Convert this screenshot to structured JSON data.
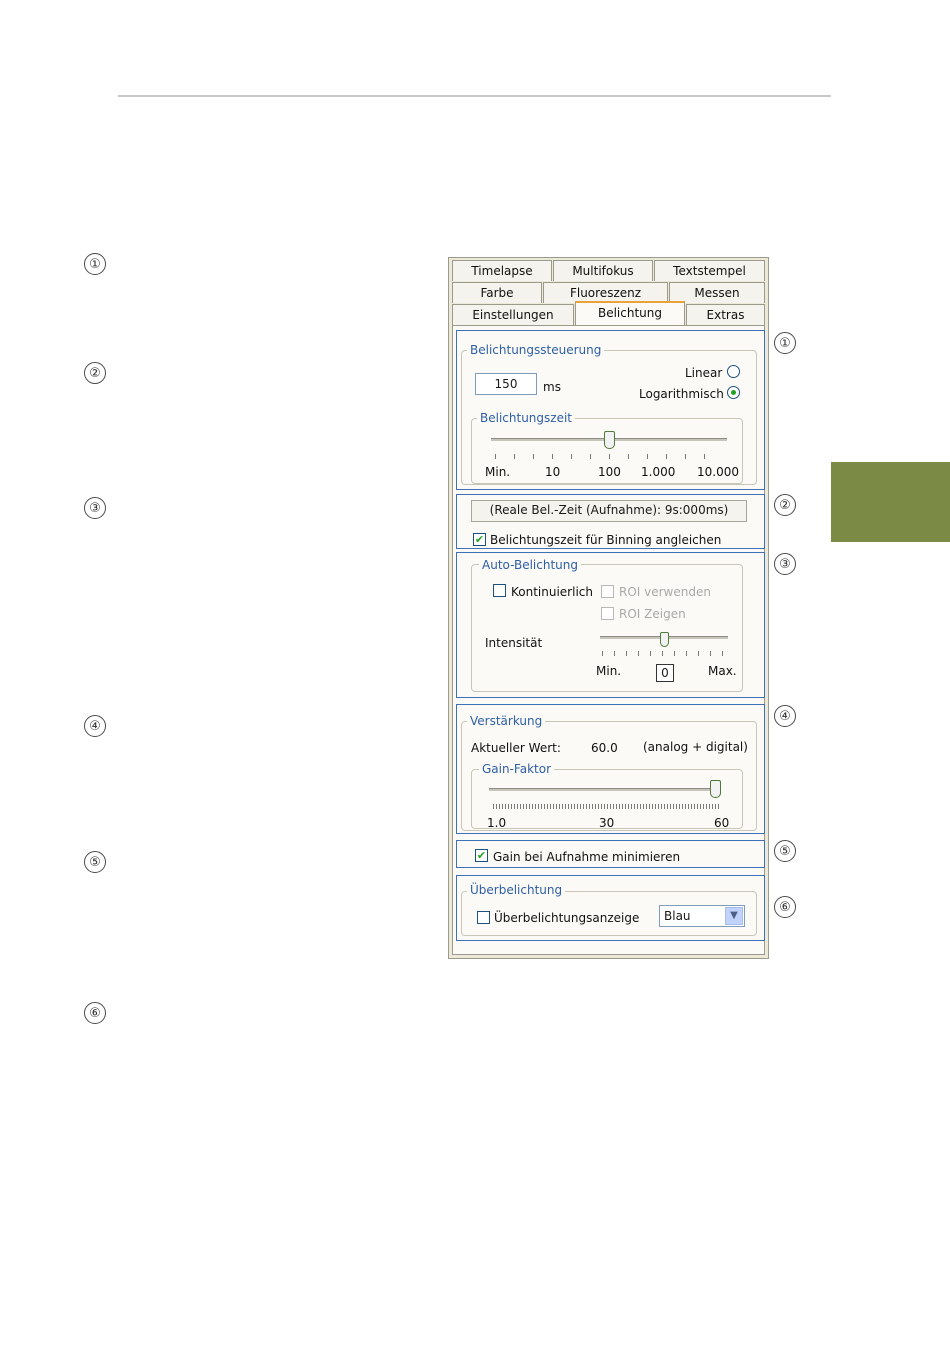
{
  "markers": [
    "①",
    "②",
    "③",
    "④",
    "⑤",
    "⑥"
  ],
  "tabs": {
    "row1": [
      "Timelapse",
      "Multifokus",
      "Textstempel"
    ],
    "row2": [
      "Farbe",
      "Fluoreszenz",
      "Messen"
    ],
    "row3": [
      "Einstellungen",
      "Belichtung",
      "Extras"
    ],
    "active": "Belichtung"
  },
  "exposure_control": {
    "title": "Belichtungssteuerung",
    "value": "150",
    "unit": "ms",
    "mode_linear": "Linear",
    "mode_log": "Logarithmisch",
    "selected_mode": "Logarithmisch",
    "time_group": "Belichtungszeit",
    "slider_ticks": [
      "Min.",
      "10",
      "100",
      "1.000",
      "10.000"
    ],
    "slider_position": 0.5
  },
  "real_time": {
    "readout": "(Reale Bel.-Zeit (Aufnahme): 9s:000ms)",
    "binning_label": "Belichtungszeit für Binning angleichen",
    "binning_checked": true
  },
  "auto_exposure": {
    "title": "Auto-Belichtung",
    "continuous_label": "Kontinuierlich",
    "continuous_checked": false,
    "roi_use": "ROI verwenden",
    "roi_show": "ROI Zeigen",
    "intensity_label": "Intensität",
    "min_label": "Min.",
    "max_label": "Max.",
    "intensity_value": "0",
    "intensity_position": 0.5
  },
  "gain": {
    "title": "Verstärkung",
    "current_label": "Aktueller Wert:",
    "current_value": "60.0",
    "mode": "(analog + digital)",
    "factor_group": "Gain-Faktor",
    "ticks": [
      "1.0",
      "30",
      "60"
    ],
    "factor_position": 1.0
  },
  "gain_minimize": {
    "label": "Gain bei Aufnahme minimieren",
    "checked": true
  },
  "overexposure": {
    "title": "Überbelichtung",
    "display_label": "Überbelichtungsanzeige",
    "display_checked": false,
    "color": "Blau"
  },
  "colors": {
    "accent_green": "#7b8a45",
    "highlight_blue": "#3f6fb6",
    "check_green": "#21a121"
  }
}
